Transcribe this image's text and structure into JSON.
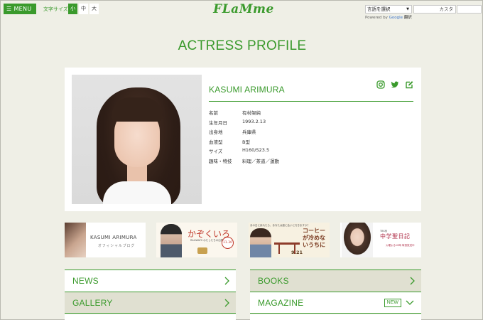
{
  "header": {
    "menu_label": "MENU",
    "fontsize_label": "文字サイズ",
    "fontsize_options": [
      "小",
      "中",
      "大"
    ],
    "logo": "FLaMme",
    "translate_select": "言語を選択",
    "translate_credit_prefix": "Powered by",
    "translate_credit_brand": "Google",
    "translate_credit_link": "翻訳",
    "search_placeholder": "カスタ"
  },
  "page_title": "ACTRESS PROFILE",
  "profile": {
    "name": "KASUMI ARIMURA",
    "social_icons": [
      "instagram-icon",
      "twitter-icon",
      "blog-edit-icon"
    ],
    "info": [
      {
        "key": "名前",
        "value": "有村架純"
      },
      {
        "key": "生年月日",
        "value": "1993.2.13"
      },
      {
        "key": "出身地",
        "value": "兵庫県"
      },
      {
        "key": "血液型",
        "value": "B型"
      },
      {
        "key": "サイズ",
        "value": "H160/S23.5"
      },
      {
        "key": "趣味・特技",
        "value": "料理／茶道／運動"
      }
    ]
  },
  "banners": {
    "blog": {
      "title": "KASUMI ARIMURA",
      "subtitle": "オフィシャルブログ"
    },
    "kazokuiro": {
      "title": "かぞくいろ",
      "subtitle": "RAILWAYS わたしたちの出発",
      "badge": "11.30"
    },
    "coffee": {
      "top": "あの日に戻れたら、あなたは誰に会いに行きますか？",
      "title": "コーヒーが冷めないうちに",
      "date": "9.21"
    },
    "diary": {
      "top": "TBS系",
      "title": "中学聖日記",
      "note": "火曜よる10時 毎週放送中"
    }
  },
  "nav": {
    "news": "NEWS",
    "gallery": "GALLERY",
    "books": "BOOKS",
    "magazine": "MAGAZINE",
    "new_badge": "NEW"
  },
  "colors": {
    "accent": "#3a9a2c",
    "background": "#efefe6",
    "card": "#ffffff",
    "nav_alt": "#e0e0d1"
  }
}
